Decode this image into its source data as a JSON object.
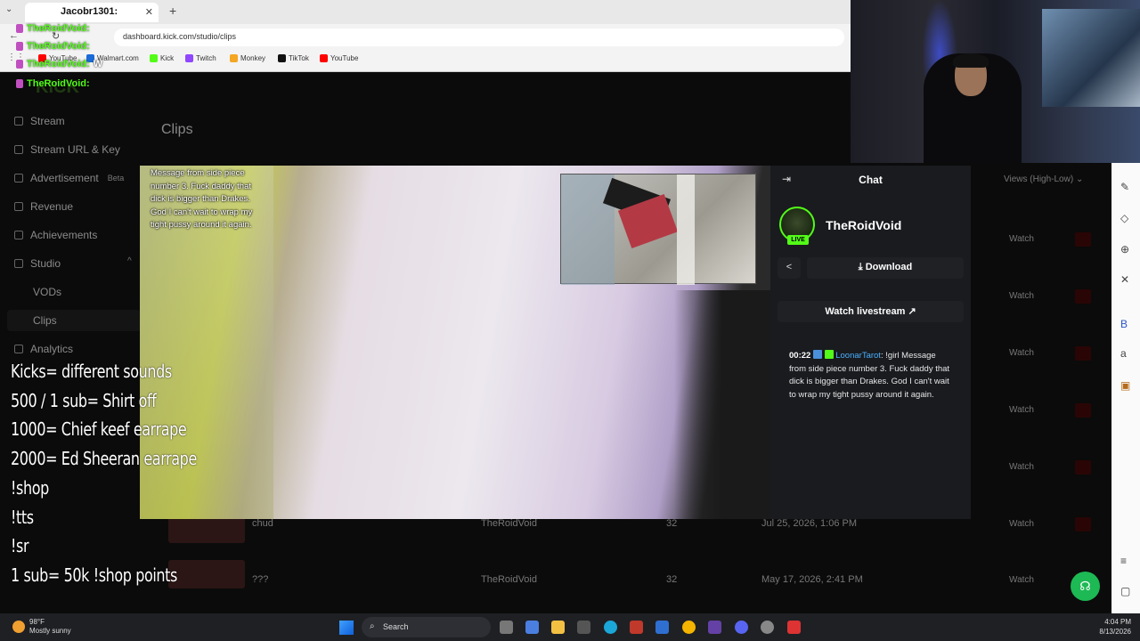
{
  "browser": {
    "tab_title": "Jacobr1301:",
    "url": "dashboard.kick.com/studio/clips",
    "bookmarks": [
      "YouTube",
      "Walmart.com",
      "Kick",
      "Twitch",
      "Monkey",
      "TikTok",
      "YouTube"
    ]
  },
  "overlay_chat": {
    "lines": [
      {
        "user": "TheRoidVoid:"
      },
      {
        "user": "TheRoidVoid:"
      },
      {
        "user": "TheRoidVoid:",
        "suffix": "W"
      },
      {
        "user": "TheRoidVoid:"
      }
    ]
  },
  "sidebar": {
    "logo": "KICK",
    "items": [
      {
        "label": "Stream"
      },
      {
        "label": "Stream URL & Key"
      },
      {
        "label": "Advertisement",
        "badge": "Beta"
      },
      {
        "label": "Revenue"
      },
      {
        "label": "Achievements"
      },
      {
        "label": "Studio"
      },
      {
        "label": "VODs"
      },
      {
        "label": "Clips"
      },
      {
        "label": "Analytics"
      }
    ]
  },
  "page": {
    "title": "Clips",
    "sort_label": "Views (High-Low)",
    "watch_label": "Watch",
    "rows": [
      {
        "title": "chud",
        "channel": "TheRoidVoid",
        "views": "32",
        "date": "Jul 25, 2026, 1:06 PM"
      },
      {
        "title": "???",
        "channel": "TheRoidVoid",
        "views": "32",
        "date": "May 17, 2026, 2:41 PM"
      }
    ]
  },
  "modal": {
    "video_message": "Message from side piece number 3. Fuck daddy that dick is bigger than Drakes. God I can't wait to wrap my tight pussy around it again.",
    "chat_header": "Chat",
    "channel_name": "TheRoidVoid",
    "live_badge": "LIVE",
    "download_label": "Download",
    "watch_livestream_label": "Watch livestream",
    "chat_message": {
      "time": "00:22",
      "user": "LoonarTarot",
      "text": ": !girl Message from side piece number 3. Fuck daddy that dick is bigger than Drakes. God I can't wait to wrap my tight pussy around it again."
    }
  },
  "commands": [
    "Kicks= different sounds",
    "500 / 1 sub= Shirt off",
    "1000= Chief keef earrape",
    "2000= Ed Sheeran earrape",
    "!shop",
    "!tts",
    "!sr",
    "1 sub= 50k !shop points"
  ],
  "taskbar": {
    "weather_temp": "98°F",
    "weather_desc": "Mostly sunny",
    "search_label": "Search",
    "time": "4:04 PM",
    "date": "8/13/2026"
  },
  "colors": {
    "kick_green": "#53fc18",
    "chat_panel_bg": "#191b1f",
    "username_blue": "#4ab0ff"
  }
}
